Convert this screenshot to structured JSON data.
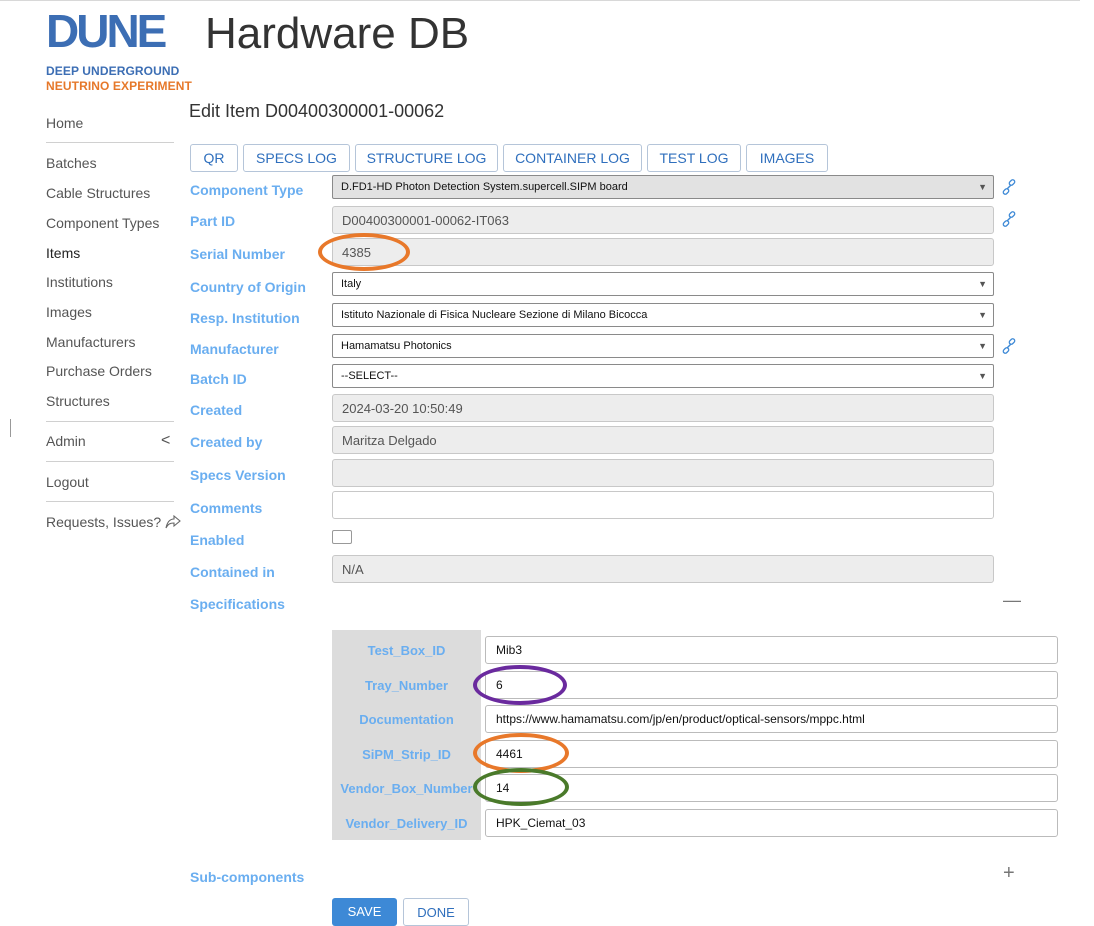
{
  "header": {
    "logo_text": "DUNE",
    "logo_line1": "DEEP UNDERGROUND",
    "logo_line2": "NEUTRINO EXPERIMENT",
    "app_title": "Hardware DB",
    "page_heading": "Edit Item D00400300001-00062"
  },
  "sidebar": {
    "home": "Home",
    "items": [
      "Batches",
      "Cable Structures",
      "Component Types",
      "Items",
      "Institutions",
      "Images",
      "Manufacturers",
      "Purchase Orders",
      "Structures"
    ],
    "admin": "Admin",
    "admin_chevron": "<",
    "logout": "Logout",
    "requests": "Requests, Issues?"
  },
  "tabs": [
    "QR",
    "SPECS LOG",
    "STRUCTURE LOG",
    "CONTAINER LOG",
    "TEST LOG",
    "IMAGES"
  ],
  "form": {
    "component_type": {
      "label": "Component Type",
      "value": "D.FD1-HD Photon Detection System.supercell.SIPM board"
    },
    "part_id": {
      "label": "Part ID",
      "value": "D00400300001-00062-IT063"
    },
    "serial_number": {
      "label": "Serial Number",
      "value": "4385"
    },
    "country_of_origin": {
      "label": "Country of Origin",
      "value": "Italy"
    },
    "resp_institution": {
      "label": "Resp. Institution",
      "value": "Istituto Nazionale di Fisica Nucleare Sezione di Milano Bicocca"
    },
    "manufacturer": {
      "label": "Manufacturer",
      "value": "Hamamatsu Photonics"
    },
    "batch_id": {
      "label": "Batch ID",
      "value": "--SELECT--"
    },
    "created": {
      "label": "Created",
      "value": "2024-03-20 10:50:49"
    },
    "created_by": {
      "label": "Created by",
      "value": "Maritza Delgado"
    },
    "specs_version": {
      "label": "Specs Version",
      "value": ""
    },
    "comments": {
      "label": "Comments",
      "value": ""
    },
    "enabled": {
      "label": "Enabled",
      "checked": false
    },
    "contained_in": {
      "label": "Contained in",
      "value": "N/A"
    },
    "specifications": {
      "label": "Specifications",
      "toggle": "—"
    },
    "subcomponents": {
      "label": "Sub-components",
      "toggle": "+"
    }
  },
  "specifications": {
    "rows": [
      {
        "key": "Test_Box_ID",
        "value": "Mib3"
      },
      {
        "key": "Tray_Number",
        "value": "6"
      },
      {
        "key": "Documentation",
        "value": "https://www.hamamatsu.com/jp/en/product/optical-sensors/mppc.html"
      },
      {
        "key": "SiPM_Strip_ID",
        "value": "4461"
      },
      {
        "key": "Vendor_Box_Number",
        "value": "14"
      },
      {
        "key": "Vendor_Delivery_ID",
        "value": "HPK_Ciemat_03"
      }
    ]
  },
  "buttons": {
    "save": "SAVE",
    "done": "DONE"
  },
  "colors": {
    "accent": "#3d89d6",
    "label": "#6aaef0",
    "annotation_orange": "#e8782a",
    "annotation_purple": "#6a2a9e",
    "annotation_green": "#4a7a2a"
  }
}
